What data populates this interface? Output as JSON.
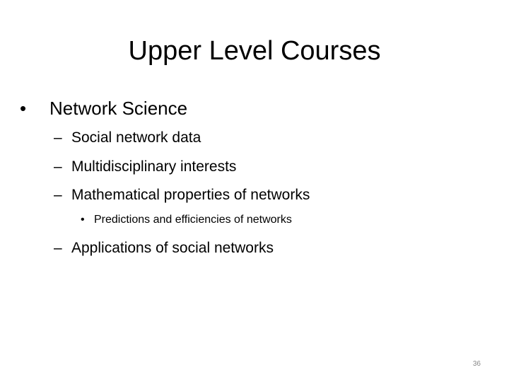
{
  "slide": {
    "title": "Upper Level Courses",
    "bullets": [
      {
        "marker": "•",
        "text": "Network Science"
      },
      {
        "marker": "–",
        "text": "Social network data"
      },
      {
        "marker": "–",
        "text": "Multidisciplinary interests"
      },
      {
        "marker": "–",
        "text": "Mathematical properties of networks"
      },
      {
        "marker": "•",
        "text": "Predictions and efficiencies of networks"
      },
      {
        "marker": "–",
        "text": "Applications of social networks"
      }
    ],
    "page_number": "36"
  }
}
